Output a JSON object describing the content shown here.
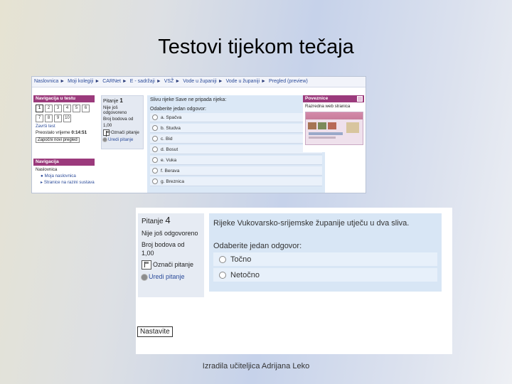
{
  "slide": {
    "title": "Testovi tijekom tečaja",
    "footer": "Izradila učiteljica Adrijana Leko"
  },
  "shot1": {
    "breadcrumb": [
      "Naslovnica",
      "Moji kolegiji",
      "CARNet",
      "E - sadržaji",
      "VSŽ",
      "Vode u županiji",
      "Vode u županiji",
      "Pregled (preview)"
    ],
    "breadcrumb_sep": "►",
    "quiz_nav": {
      "title": "Navigacija u testu",
      "row1": [
        "1",
        "2",
        "3",
        "4",
        "5",
        "6"
      ],
      "row2": [
        "7",
        "8",
        "9",
        "10"
      ],
      "finish": "Završi test",
      "time_left_label": "Preostalo vrijeme",
      "time_left": "0:14:51",
      "new_preview": "Započni novi pregled"
    },
    "navigation": {
      "title": "Navigacija",
      "home": "Naslovnica",
      "my_home": "Moja naslovnica",
      "site_pages": "Stranice na razini sustava"
    },
    "question_info": {
      "label": "Pitanje",
      "number": "1",
      "status": "Nije još odgovoreno",
      "points_label": "Broj bodova od",
      "points": "1,00",
      "flag": "Označi pitanje",
      "edit": "Uredi pitanje"
    },
    "question": {
      "prompt": "Slivu rijeke Save ne pripada rijeka:",
      "select_one": "Odaberite jedan odgovor:",
      "answers": [
        "a. Spačva",
        "b. Studva",
        "c. Bid",
        "d. Bosut",
        "e. Vuka",
        "f. Berava",
        "g. Breznica"
      ]
    },
    "links_block": {
      "title": "Poveznice",
      "label": "Razredna web stranica"
    }
  },
  "shot2": {
    "question_info": {
      "label": "Pitanje",
      "number": "4",
      "status": "Nije još odgovoreno",
      "points_label": "Broj bodova od",
      "points": "1,00",
      "flag": "Označi pitanje",
      "edit": "Uredi pitanje"
    },
    "question": {
      "prompt": "Rijeke Vukovarsko-srijemske županije utječu u dva sliva.",
      "select_one": "Odaberite jedan odgovor:",
      "answers": [
        "Točno",
        "Netočno"
      ]
    },
    "next_button": "Nastavite"
  }
}
